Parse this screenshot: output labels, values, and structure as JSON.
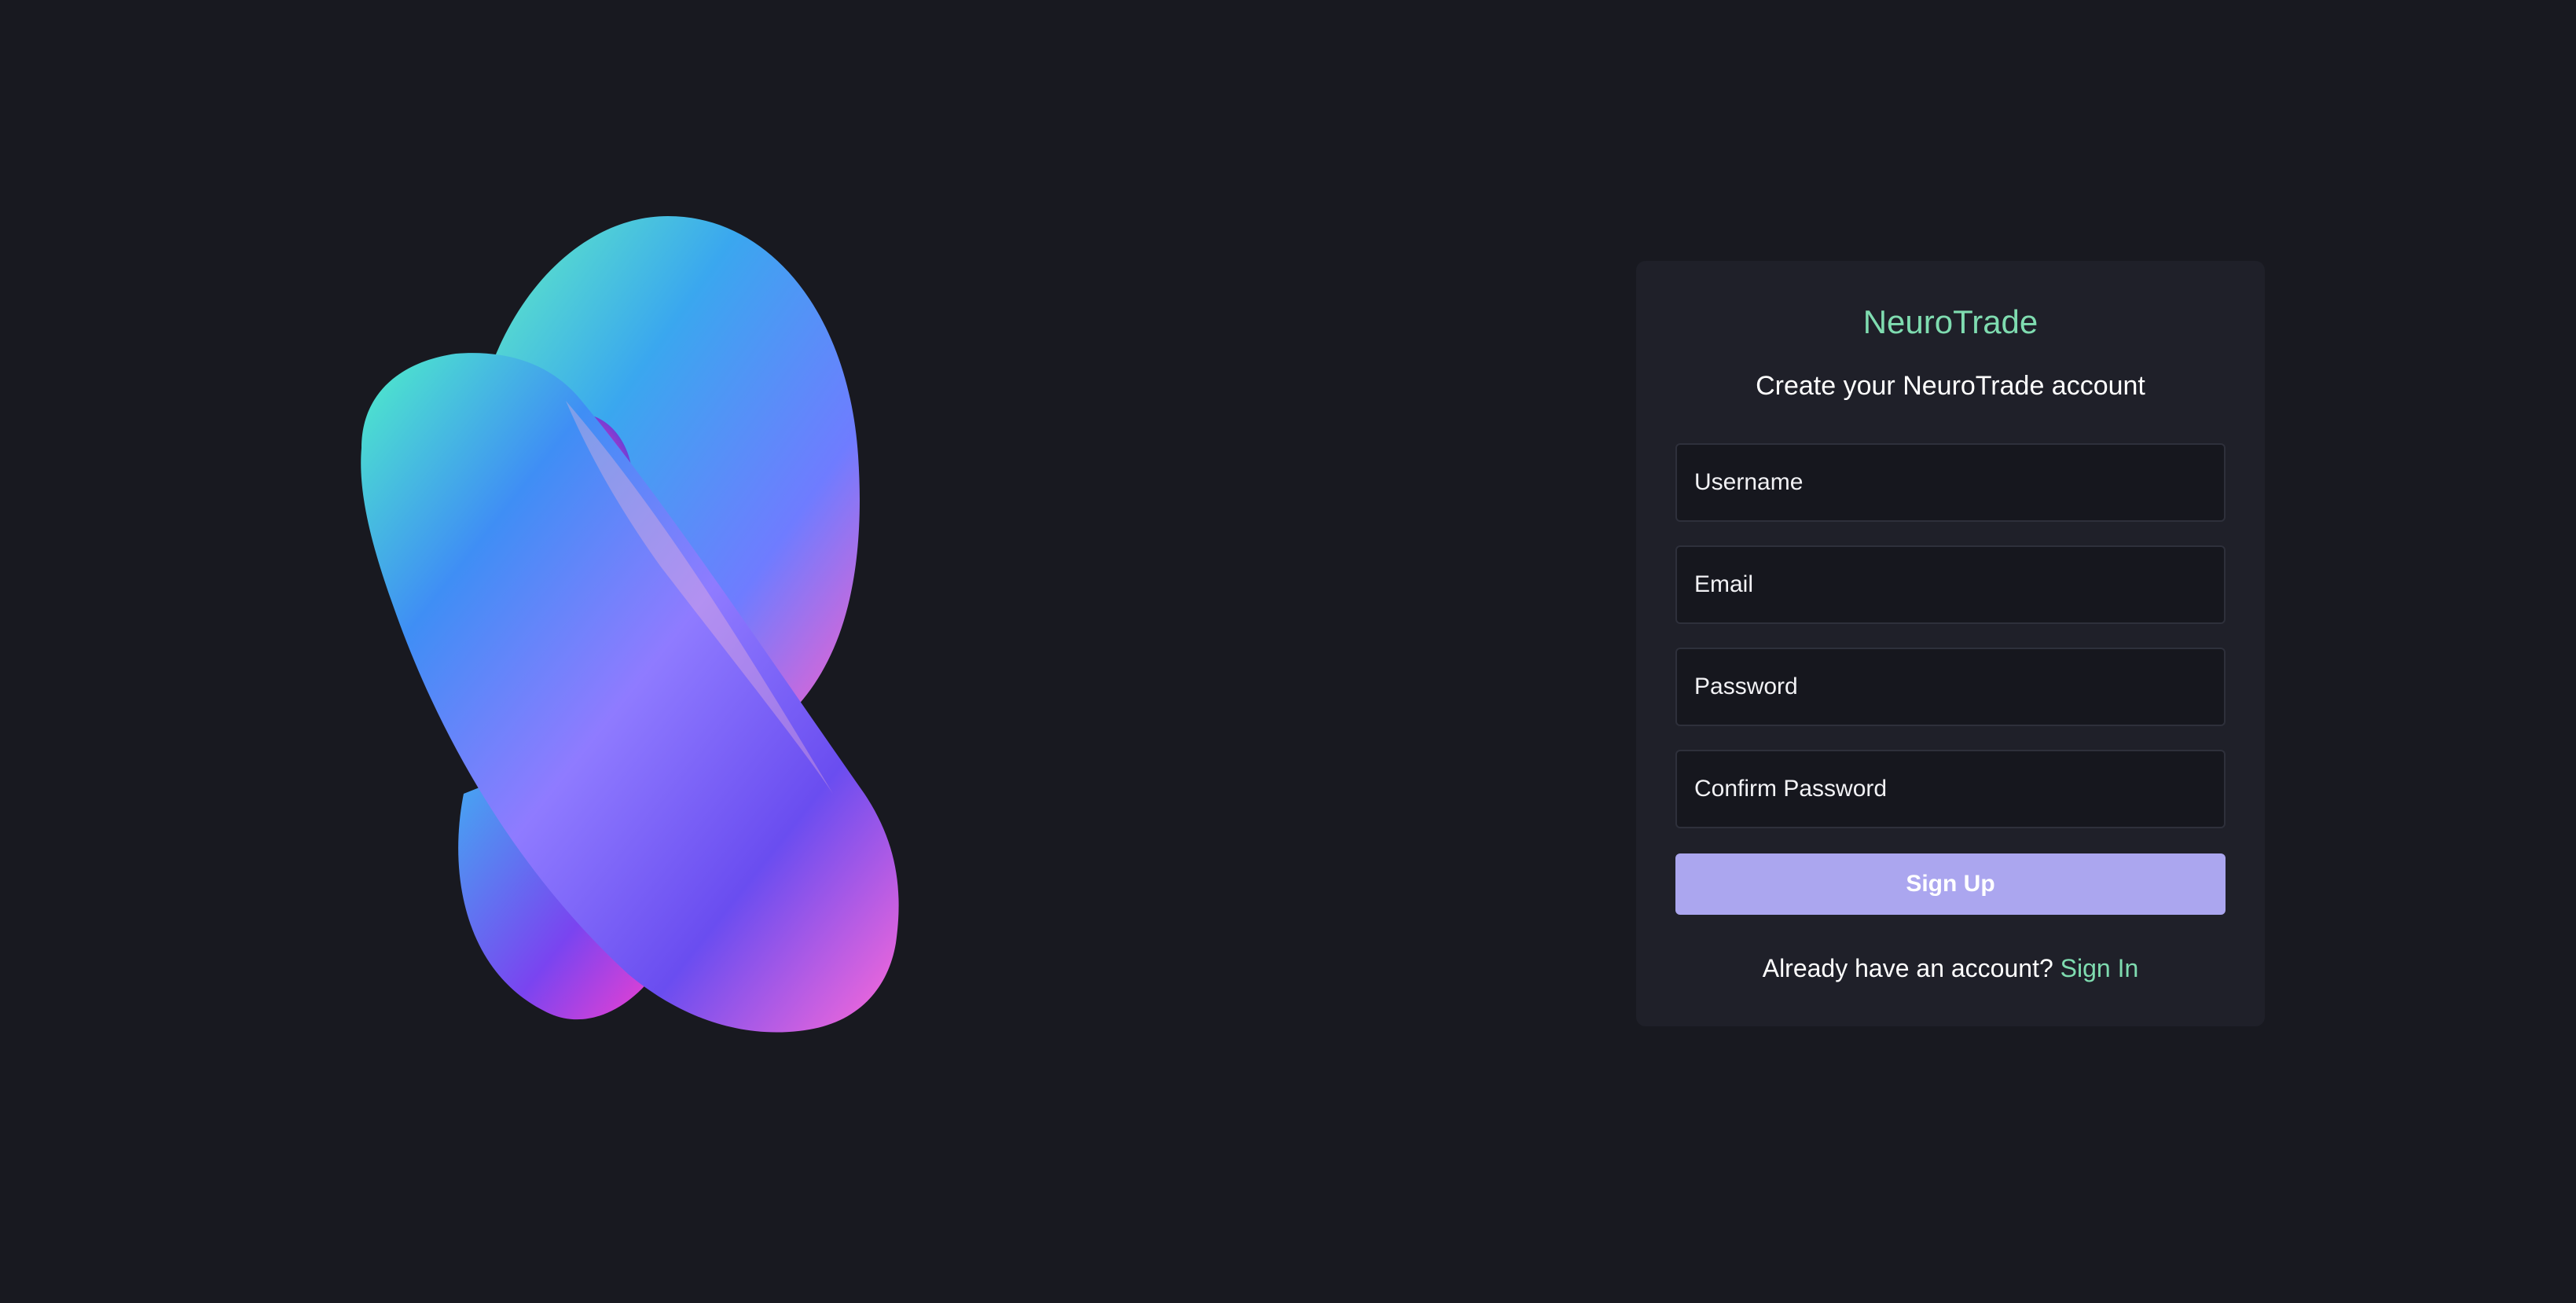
{
  "app": {
    "brand": "NeuroTrade",
    "subtitle": "Create your NeuroTrade account"
  },
  "form": {
    "username_placeholder": "Username",
    "email_placeholder": "Email",
    "password_placeholder": "Password",
    "confirm_password_placeholder": "Confirm Password",
    "submit_label": "Sign Up"
  },
  "footer": {
    "prompt": "Already have an account?",
    "link_label": "Sign In"
  },
  "colors": {
    "background": "#181920",
    "card": "#1f2029",
    "accent": "#7fdcb0",
    "button": "#aba6ef"
  },
  "illustration": {
    "name": "torus-knot-3d"
  }
}
